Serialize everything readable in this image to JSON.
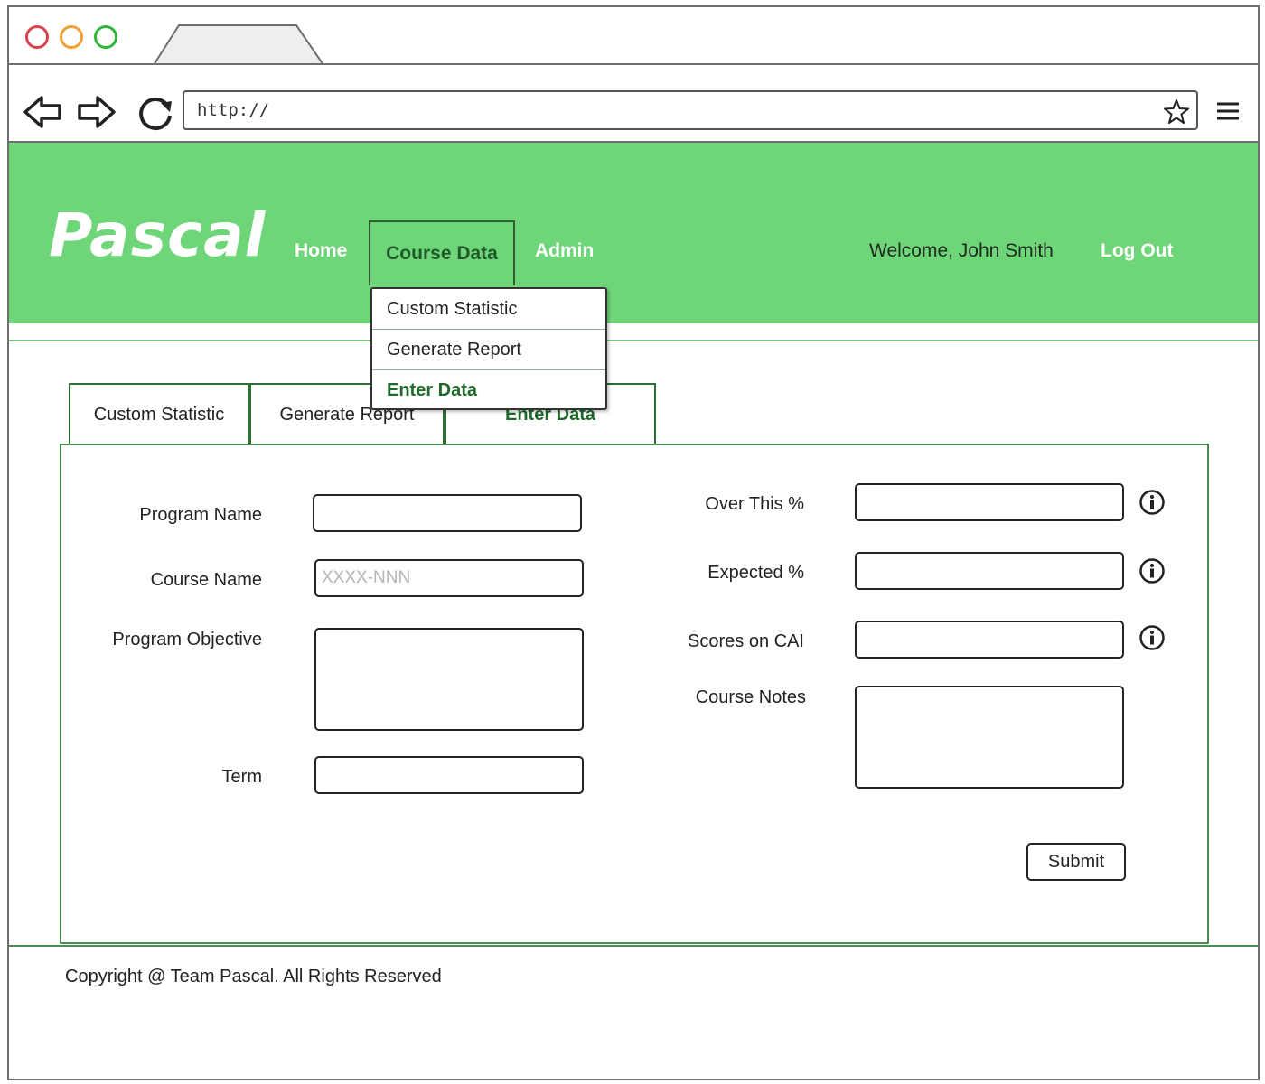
{
  "browser": {
    "url": "http://"
  },
  "header": {
    "logo": "Pascal",
    "nav": {
      "home": "Home",
      "course_data": "Course Data",
      "admin": "Admin"
    },
    "welcome": "Welcome, John Smith",
    "logout": "Log Out"
  },
  "dropdown": {
    "items": [
      {
        "label": "Custom Statistic"
      },
      {
        "label": "Generate Report"
      },
      {
        "label": "Enter Data"
      }
    ]
  },
  "tabs": [
    {
      "label": "Custom Statistic"
    },
    {
      "label": "Generate Report"
    },
    {
      "label": "Enter Data"
    }
  ],
  "form": {
    "program_name": {
      "label": "Program Name",
      "value": ""
    },
    "course_name": {
      "label": "Course Name",
      "value": "",
      "placeholder": "XXXX-NNN"
    },
    "program_objective": {
      "label": "Program Objective",
      "value": ""
    },
    "term": {
      "label": "Term",
      "value": ""
    },
    "over_this": {
      "label": "Over This %",
      "value": ""
    },
    "expected": {
      "label": "Expected %",
      "value": ""
    },
    "scores_on_cai": {
      "label": "Scores on CAI",
      "value": ""
    },
    "course_notes": {
      "label": "Course Notes",
      "value": ""
    },
    "submit_label": "Submit"
  },
  "footer": {
    "copyright": "Copyright @ Team Pascal. All Rights Reserved"
  },
  "colors": {
    "header_green": "#6fd579",
    "active_green": "#1f6a2b",
    "border_green": "#4b8c52"
  }
}
